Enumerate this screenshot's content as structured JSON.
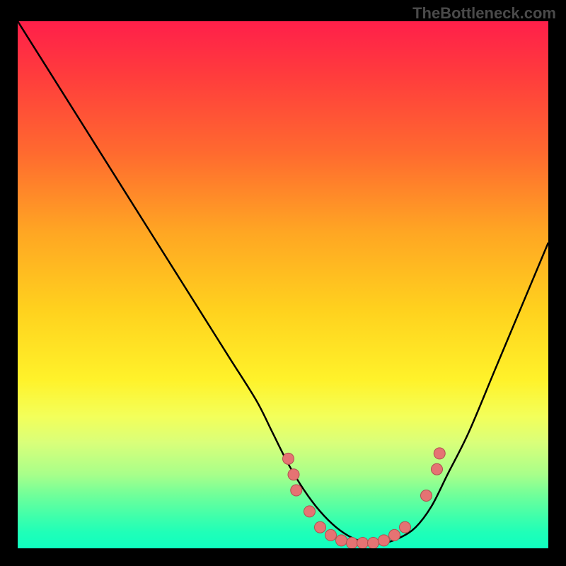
{
  "watermark": "TheBottleneck.com",
  "chart_data": {
    "type": "line",
    "title": "",
    "xlabel": "",
    "ylabel": "",
    "xlim": [
      0,
      100
    ],
    "ylim": [
      0,
      100
    ],
    "series": [
      {
        "name": "bottleneck-curve",
        "x": [
          0,
          5,
          10,
          15,
          20,
          25,
          30,
          35,
          40,
          45,
          48,
          51,
          54,
          57,
          60,
          63,
          66,
          69,
          72,
          75,
          78,
          81,
          85,
          90,
          95,
          100
        ],
        "y": [
          100,
          92,
          84,
          76,
          68,
          60,
          52,
          44,
          36,
          28,
          22,
          16,
          11,
          7,
          4,
          2,
          1,
          1,
          2,
          4,
          8,
          14,
          22,
          34,
          46,
          58
        ]
      }
    ],
    "markers": {
      "name": "optimal-zone-points",
      "x": [
        51,
        52,
        52.5,
        55,
        57,
        59,
        61,
        63,
        65,
        67,
        69,
        71,
        73,
        77,
        79,
        79.5
      ],
      "y": [
        17,
        14,
        11,
        7,
        4,
        2.5,
        1.5,
        1,
        1,
        1,
        1.5,
        2.5,
        4,
        10,
        15,
        18
      ]
    },
    "annotations": []
  }
}
